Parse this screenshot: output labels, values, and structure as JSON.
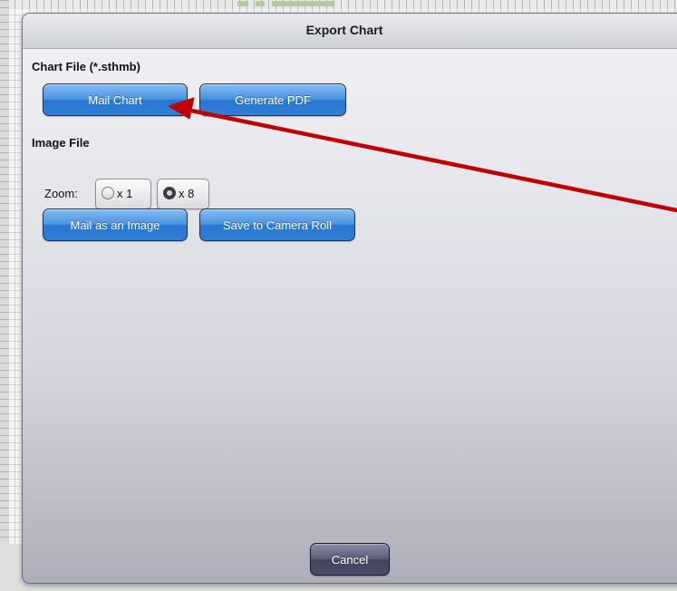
{
  "dialog": {
    "title": "Export Chart",
    "chart_file_section": {
      "label": "Chart File (*.sthmb)",
      "mail_chart_label": "Mail Chart",
      "generate_pdf_label": "Generate PDF"
    },
    "image_file_section": {
      "label": "Image File",
      "zoom_label": "Zoom:",
      "zoom_options": [
        {
          "label": "x 1",
          "selected": false
        },
        {
          "label": "x 8",
          "selected": true
        }
      ],
      "mail_image_label": "Mail as an Image",
      "save_camera_roll_label": "Save to Camera Roll"
    },
    "cancel_label": "Cancel"
  },
  "colors": {
    "primary_button": "#3584de",
    "cancel_button": "#55546f",
    "annotation_arrow": "#c00000"
  },
  "annotation": {
    "type": "arrow",
    "points_to": "mail-chart-button"
  }
}
